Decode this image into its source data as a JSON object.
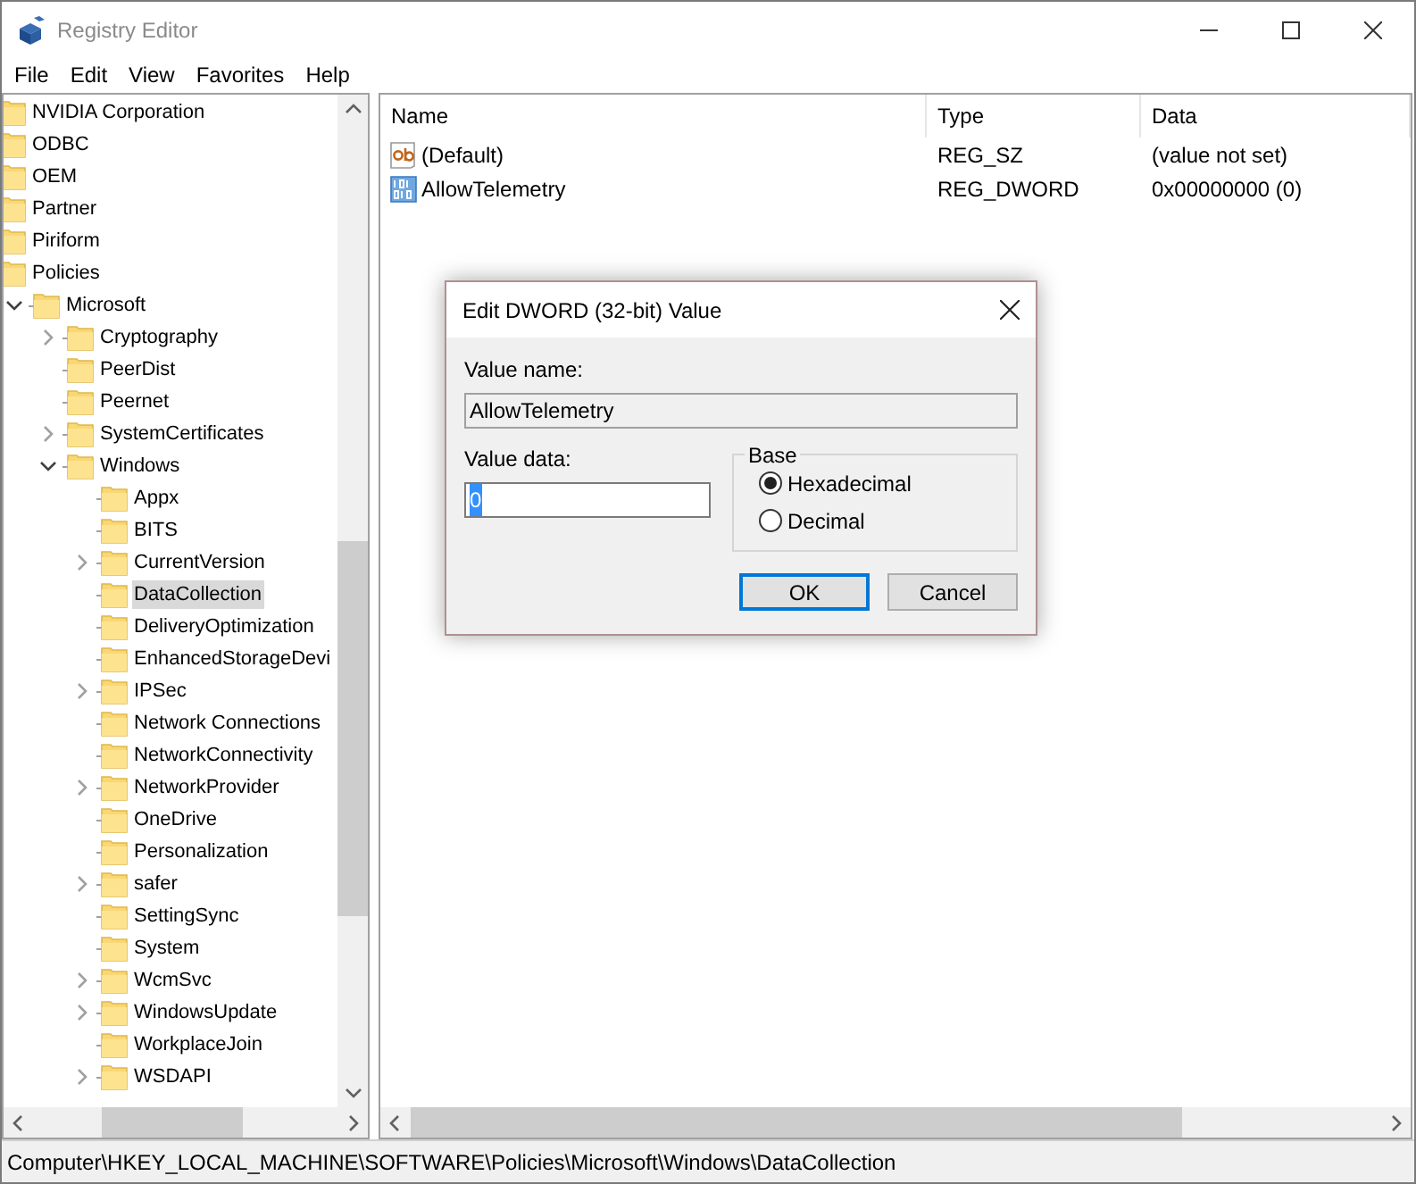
{
  "window": {
    "title": "Registry Editor"
  },
  "menu": [
    "File",
    "Edit",
    "View",
    "Favorites",
    "Help"
  ],
  "tree": [
    {
      "label": "NVIDIA Corporation",
      "selected": false
    },
    {
      "label": "ODBC",
      "selected": false
    },
    {
      "label": "OEM",
      "selected": false
    },
    {
      "label": "Partner",
      "selected": false
    },
    {
      "label": "Piriform",
      "selected": false
    },
    {
      "label": "Policies",
      "selected": false,
      "children": [
        {
          "label": "Microsoft",
          "expandable": true,
          "expanded": true,
          "selected": false,
          "children": [
            {
              "label": "Cryptography",
              "expandable": true,
              "expanded": false,
              "selected": false
            },
            {
              "label": "PeerDist",
              "expandable": false,
              "expanded": false,
              "selected": false
            },
            {
              "label": "Peernet",
              "expandable": false,
              "expanded": false,
              "selected": false
            },
            {
              "label": "SystemCertificates",
              "expandable": true,
              "expanded": false,
              "selected": false
            },
            {
              "label": "Windows",
              "expandable": true,
              "expanded": true,
              "selected": false,
              "children": [
                {
                  "label": "Appx",
                  "expandable": false,
                  "expanded": false,
                  "selected": false
                },
                {
                  "label": "BITS",
                  "expandable": false,
                  "expanded": false,
                  "selected": false
                },
                {
                  "label": "CurrentVersion",
                  "expandable": true,
                  "expanded": false,
                  "selected": false
                },
                {
                  "label": "DataCollection",
                  "expandable": false,
                  "expanded": false,
                  "selected": true
                },
                {
                  "label": "DeliveryOptimization",
                  "expandable": false,
                  "expanded": false,
                  "selected": false
                },
                {
                  "label": "EnhancedStorageDevi",
                  "expandable": false,
                  "expanded": false,
                  "selected": false
                },
                {
                  "label": "IPSec",
                  "expandable": true,
                  "expanded": false,
                  "selected": false
                },
                {
                  "label": "Network Connections",
                  "expandable": false,
                  "expanded": false,
                  "selected": false
                },
                {
                  "label": "NetworkConnectivity",
                  "expandable": false,
                  "expanded": false,
                  "selected": false
                },
                {
                  "label": "NetworkProvider",
                  "expandable": true,
                  "expanded": false,
                  "selected": false
                },
                {
                  "label": "OneDrive",
                  "expandable": false,
                  "expanded": false,
                  "selected": false
                },
                {
                  "label": "Personalization",
                  "expandable": false,
                  "expanded": false,
                  "selected": false
                },
                {
                  "label": "safer",
                  "expandable": true,
                  "expanded": false,
                  "selected": false
                },
                {
                  "label": "SettingSync",
                  "expandable": false,
                  "expanded": false,
                  "selected": false
                },
                {
                  "label": "System",
                  "expandable": false,
                  "expanded": false,
                  "selected": false
                },
                {
                  "label": "WcmSvc",
                  "expandable": true,
                  "expanded": false,
                  "selected": false
                },
                {
                  "label": "WindowsUpdate",
                  "expandable": true,
                  "expanded": false,
                  "selected": false
                },
                {
                  "label": "WorkplaceJoin",
                  "expandable": false,
                  "expanded": false,
                  "selected": false
                },
                {
                  "label": "WSDAPI",
                  "expandable": true,
                  "expanded": false,
                  "selected": false
                }
              ]
            }
          ]
        }
      ]
    }
  ],
  "values": {
    "columns": [
      "Name",
      "Type",
      "Data"
    ],
    "rows": [
      {
        "kind": "string",
        "name": "(Default)",
        "type": "REG_SZ",
        "data": "(value not set)"
      },
      {
        "kind": "binary",
        "name": "AllowTelemetry",
        "type": "REG_DWORD",
        "data": "0x00000000 (0)"
      }
    ]
  },
  "dialog": {
    "title": "Edit DWORD (32-bit) Value",
    "value_name_label": "Value name:",
    "value_name": "AllowTelemetry",
    "value_data_label": "Value data:",
    "value_data": "0",
    "value_data_selected": true,
    "base_label": "Base",
    "bases": [
      {
        "label": "Hexadecimal",
        "selected": true
      },
      {
        "label": "Decimal",
        "selected": false
      }
    ],
    "buttons": [
      {
        "label": "OK",
        "default": true
      },
      {
        "label": "Cancel",
        "default": false
      }
    ]
  },
  "status_bar": "Computer\\HKEY_LOCAL_MACHINE\\SOFTWARE\\Policies\\Microsoft\\Windows\\DataCollection"
}
